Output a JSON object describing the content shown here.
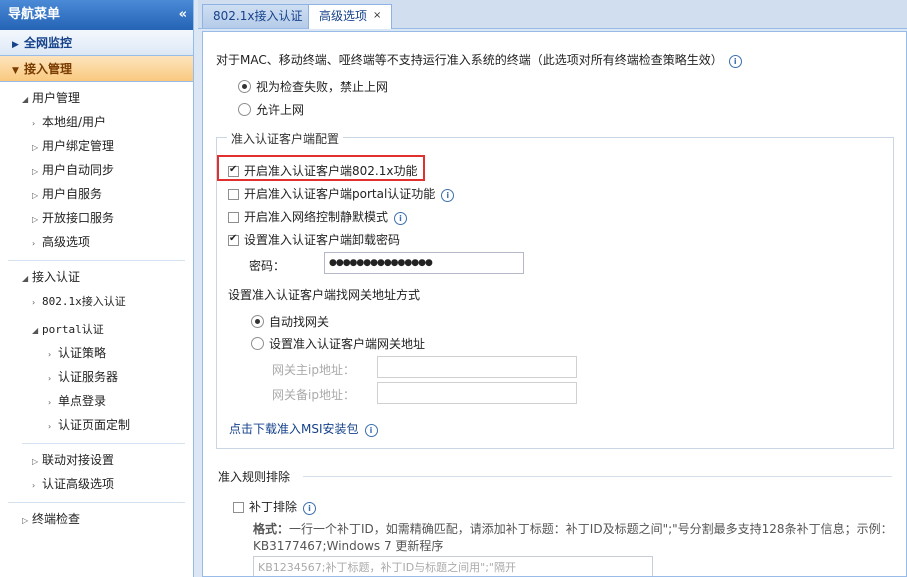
{
  "sidebar": {
    "title": "导航菜单",
    "collapse_icon": "«",
    "sections": {
      "monitor": "全网监控",
      "access": "接入管理",
      "terminal": "终端检查"
    },
    "user_mgmt": {
      "label": "用户管理",
      "items": [
        "本地组/用户",
        "用户绑定管理",
        "用户自动同步",
        "用户自服务",
        "开放接口服务",
        "高级选项"
      ]
    },
    "auth": {
      "label": "接入认证",
      "dot1x": "802.1x接入认证",
      "portal": {
        "label": "portal认证",
        "items": [
          "认证策略",
          "认证服务器",
          "单点登录",
          "认证页面定制"
        ]
      },
      "items": [
        "联动对接设置",
        "认证高级选项"
      ]
    }
  },
  "tabs": {
    "tab1": "802.1x接入认证",
    "tab2": "高级选项",
    "close_icon": "×"
  },
  "form": {
    "intro": "对于MAC、移动终端、哑终端等不支持运行准入系统的终端（此选项对所有终端检查策略生效）",
    "radio_fail": "视为检查失败，禁止上网",
    "radio_allow": "允许上网",
    "client_group": "准入认证客户端配置",
    "cb_8021x": "开启准入认证客户端802.1x功能",
    "cb_portal": "开启准入认证客户端portal认证功能",
    "cb_silent": "开启准入网络控制静默模式",
    "cb_uninstall": "设置准入认证客户端卸载密码",
    "password_label": "密码：",
    "password_value": "●●●●●●●●●●●●●●●",
    "gateway_title": "设置准入认证客户端找网关地址方式",
    "radio_auto": "自动找网关",
    "radio_set": "设置准入认证客户端网关地址",
    "gw_primary": "网关主ip地址：",
    "gw_backup": "网关备ip地址：",
    "msi_link": "点击下载准入MSI安装包",
    "rules_title": "准入规则排除",
    "patch_label": "补丁排除",
    "format_label": "格式：",
    "format_text": "一行一个补丁ID，如需精确匹配，请添加补丁标题：补丁ID及标题之间\";\"号分割最多支持128条补丁信息；示例：",
    "format_example": "KB3177467;Windows 7 更新程序",
    "patch_placeholder": "KB1234567;补丁标题，补丁ID与标题之间用\";\"隔开"
  },
  "colors": {
    "accent": "#15428b",
    "highlight": "#e03030",
    "active_section": "#f9c97f"
  }
}
